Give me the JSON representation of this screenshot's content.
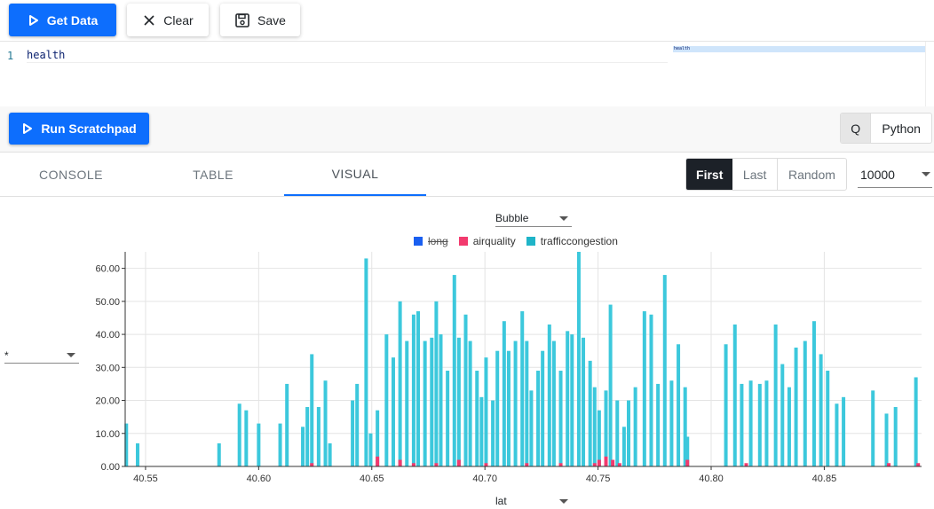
{
  "toolbar": {
    "get_data_label": "Get Data",
    "clear_label": "Clear",
    "save_label": "Save"
  },
  "editor": {
    "line_number": "1",
    "code": "health",
    "minimap_text": "health"
  },
  "scratchpad": {
    "run_label": "Run Scratchpad",
    "languages": [
      "Q",
      "Python"
    ],
    "selected_language": "Q"
  },
  "tabs": [
    "CONSOLE",
    "TABLE",
    "VISUAL"
  ],
  "active_tab": "VISUAL",
  "sampling": {
    "options": [
      "First",
      "Last",
      "Random"
    ],
    "selected": "First",
    "count": "10000"
  },
  "visual": {
    "chart_type_select": "Bubble",
    "y_select": "*",
    "x_select": "lat"
  },
  "colors": {
    "primary": "#0d6efd",
    "long": "#1a5ff0",
    "airquality": "#f23a6e",
    "trafficcongestion": "#1fb4c8",
    "bar_fill": "#3cc8dc",
    "dark_button": "#1c2128"
  },
  "chart_data": {
    "type": "bar",
    "xlabel": "lat",
    "ylabel": "",
    "xlim": [
      40.541,
      40.893
    ],
    "ylim": [
      0,
      65
    ],
    "x_ticks": [
      "40.55",
      "40.60",
      "40.65",
      "40.70",
      "40.75",
      "40.80",
      "40.85"
    ],
    "x_tick_values": [
      40.55,
      40.6,
      40.65,
      40.7,
      40.75,
      40.8,
      40.85
    ],
    "y_ticks": [
      "0.00",
      "10.00",
      "20.00",
      "30.00",
      "40.00",
      "50.00",
      "60.00"
    ],
    "y_tick_values": [
      0,
      10,
      20,
      30,
      40,
      50,
      60
    ],
    "grid": true,
    "legend": [
      {
        "name": "long",
        "color": "#1a5ff0",
        "hidden": true
      },
      {
        "name": "airquality",
        "color": "#f23a6e",
        "hidden": false
      },
      {
        "name": "trafficcongestion",
        "color": "#1fb4c8",
        "hidden": false
      }
    ],
    "series": [
      {
        "name": "trafficcongestion",
        "x": [
          40.5415,
          40.5465,
          40.5825,
          40.5915,
          40.5945,
          40.6,
          40.6095,
          40.6125,
          40.6195,
          40.6215,
          40.6235,
          40.6265,
          40.6295,
          40.6315,
          40.6415,
          40.6435,
          40.6475,
          40.6495,
          40.6525,
          40.6565,
          40.6595,
          40.6625,
          40.6655,
          40.6685,
          40.6705,
          40.6735,
          40.6765,
          40.6785,
          40.6805,
          40.6835,
          40.6865,
          40.6885,
          40.6915,
          40.6935,
          40.6965,
          40.6985,
          40.7005,
          40.7035,
          40.7055,
          40.7085,
          40.7105,
          40.7135,
          40.7165,
          40.7185,
          40.7205,
          40.7235,
          40.7255,
          40.7285,
          40.7305,
          40.7335,
          40.7365,
          40.7385,
          40.7415,
          40.7435,
          40.7465,
          40.7485,
          40.7505,
          40.7535,
          40.7555,
          40.7585,
          40.7615,
          40.7635,
          40.7665,
          40.7705,
          40.7735,
          40.7765,
          40.7795,
          40.7825,
          40.7855,
          40.7885,
          40.7895,
          40.8065,
          40.8105,
          40.8135,
          40.8175,
          40.8215,
          40.8245,
          40.8285,
          40.8315,
          40.8345,
          40.8375,
          40.8415,
          40.8455,
          40.8485,
          40.8515,
          40.8555,
          40.8585,
          40.8715,
          40.8775,
          40.8815,
          40.8905
        ],
        "values": [
          13,
          7,
          7,
          19,
          17,
          13,
          13,
          25,
          12,
          18,
          34,
          18,
          26,
          7,
          20,
          25,
          63,
          10,
          17,
          40,
          33,
          50,
          38,
          46,
          47,
          38,
          39,
          50,
          40,
          29,
          58,
          39,
          46,
          38,
          29,
          21,
          33,
          20,
          35,
          44,
          35,
          38,
          47,
          38,
          23,
          29,
          35,
          43,
          38,
          29,
          41,
          40,
          65,
          39,
          32,
          24,
          17,
          23,
          49,
          20,
          12,
          20,
          24,
          47,
          46,
          25,
          58,
          26,
          37,
          24,
          9,
          37,
          43,
          25,
          26,
          25,
          26,
          43,
          31,
          24,
          36,
          38,
          44,
          34,
          29,
          19,
          21,
          23,
          16,
          18,
          27
        ]
      },
      {
        "name": "airquality",
        "x": [
          40.6235,
          40.6525,
          40.6625,
          40.6685,
          40.6785,
          40.6885,
          40.7005,
          40.7185,
          40.7335,
          40.7485,
          40.7505,
          40.7535,
          40.7565,
          40.7595,
          40.7895,
          40.8155,
          40.8785,
          40.8915
        ],
        "values": [
          1,
          3,
          2,
          1,
          1,
          2,
          1,
          1,
          1,
          1,
          2,
          3,
          2,
          1,
          2,
          1,
          1,
          1
        ]
      }
    ]
  }
}
